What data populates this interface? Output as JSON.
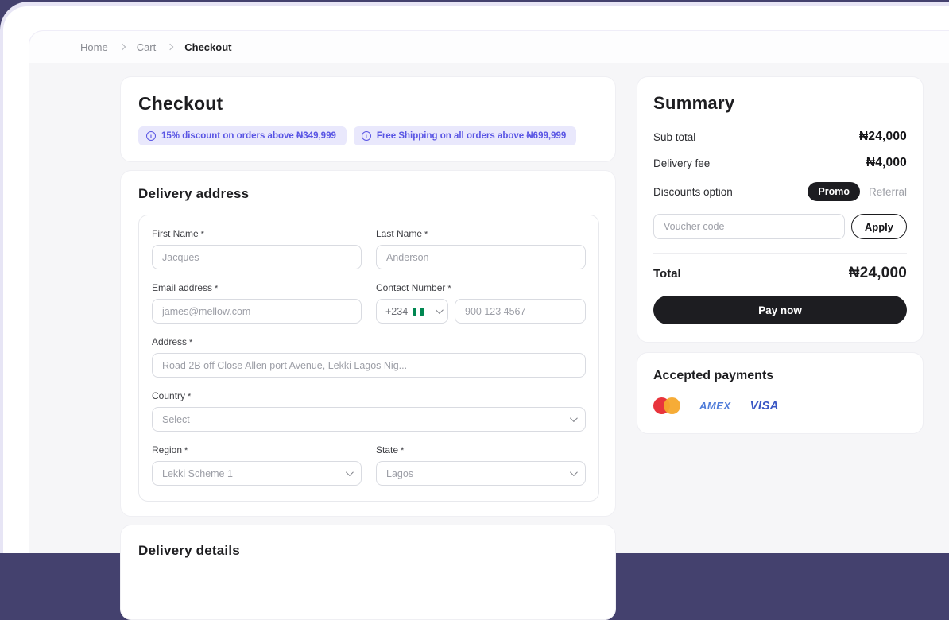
{
  "breadcrumb": {
    "items": [
      {
        "label": "Home"
      },
      {
        "label": "Cart"
      },
      {
        "label": "Checkout"
      }
    ]
  },
  "checkout": {
    "title": "Checkout",
    "badges": [
      {
        "text": "15% discount on orders above ₦349,999",
        "icon": "info-icon"
      },
      {
        "text": "Free Shipping on all orders above ₦699,999",
        "icon": "info-icon"
      }
    ]
  },
  "delivery_address": {
    "title": "Delivery address",
    "required_mark": "*",
    "first_name": {
      "label": "First Name",
      "value": "Jacques"
    },
    "last_name": {
      "label": "Last Name",
      "value": "Anderson"
    },
    "email": {
      "label": "Email address",
      "value": "james@mellow.com"
    },
    "contact": {
      "label": "Contact Number",
      "dial_code": "+234",
      "flag": "nigeria-flag",
      "value": "900 123 4567"
    },
    "address": {
      "label": "Address",
      "value": "Road 2B off Close Allen port Avenue, Lekki Lagos Nig..."
    },
    "country": {
      "label": "Country",
      "value": "Select"
    },
    "region": {
      "label": "Region",
      "value": "Lekki Scheme 1"
    },
    "state": {
      "label": "State",
      "value": "Lagos"
    }
  },
  "delivery_details": {
    "title": "Delivery details"
  },
  "summary": {
    "title": "Summary",
    "rows": [
      {
        "label": "Sub total",
        "value": "₦24,000"
      },
      {
        "label": "Delivery fee",
        "value": "₦4,000"
      }
    ],
    "discounts_label": "Discounts option",
    "promo_label": "Promo",
    "referral_label": "Referral",
    "voucher_placeholder": "Voucher code",
    "apply_label": "Apply",
    "total_label": "Total",
    "total_value": "₦24,000",
    "pay_label": "Pay now"
  },
  "payments": {
    "title": "Accepted payments",
    "methods": [
      "mastercard",
      "amex",
      "visa"
    ],
    "amex_text": "AMEX",
    "visa_text": "VISA"
  },
  "colors": {
    "outer_background": "#44416E",
    "frame_lavender": "#E7E5F5",
    "shell_background": "#F6F6F8",
    "badge_background": "#E9E8FC",
    "badge_text": "#5955E4",
    "button_black": "#1D1D21",
    "input_border": "#D9DBE1",
    "muted_text": "#9C9EA6",
    "mastercard_red": "#E8343C",
    "mastercard_orange": "#F6A82C",
    "amex_blue": "#4F7CD9",
    "visa_blue": "#3A57C4",
    "nigeria_green": "#008751"
  }
}
